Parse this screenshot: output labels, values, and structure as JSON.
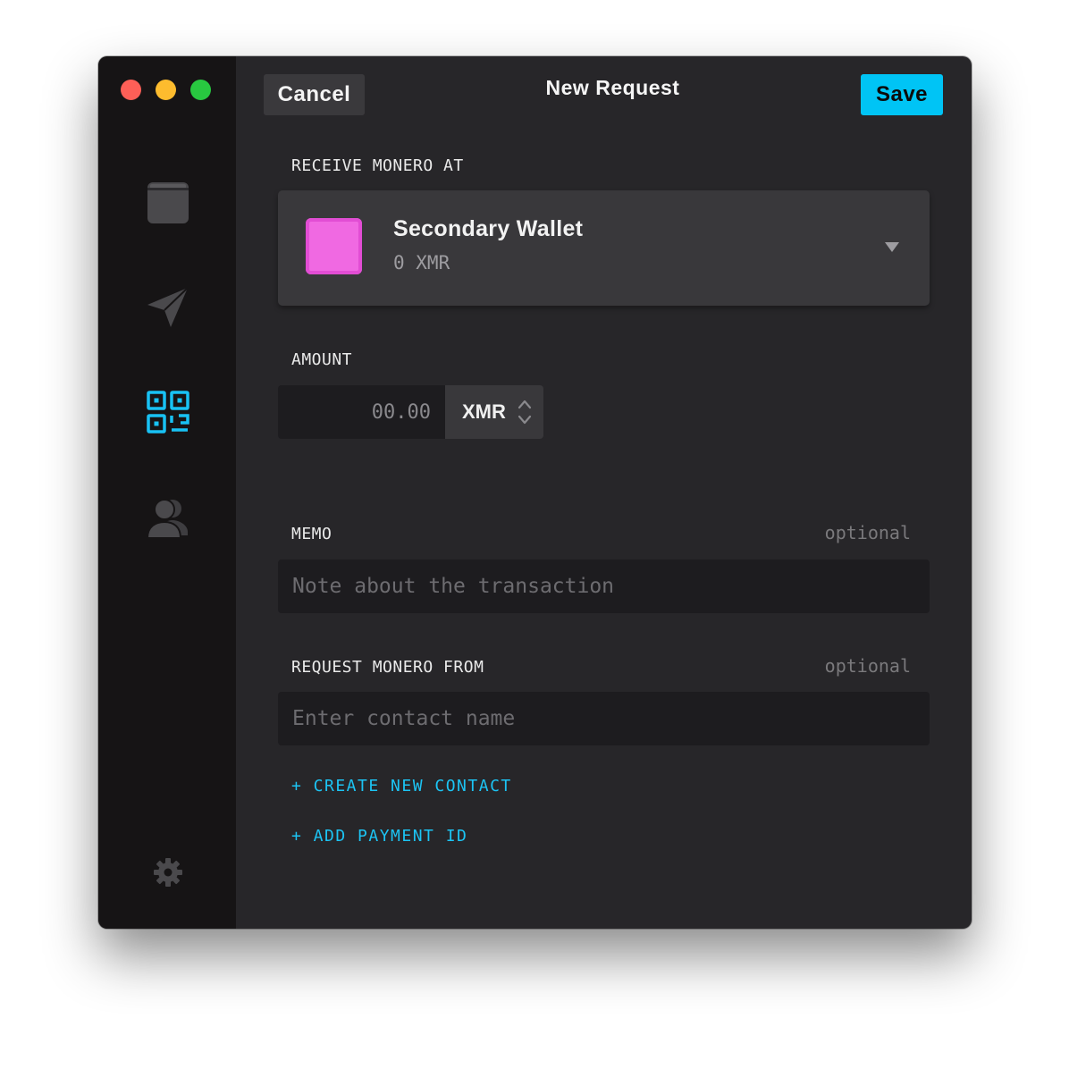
{
  "header": {
    "cancel_label": "Cancel",
    "title": "New Request",
    "save_label": "Save"
  },
  "sidebar": {
    "items": [
      {
        "id": "wallets",
        "icon": "wallet-icon",
        "active": false
      },
      {
        "id": "send",
        "icon": "paper-plane-icon",
        "active": false
      },
      {
        "id": "receive",
        "icon": "qr-code-icon",
        "active": true
      },
      {
        "id": "contacts",
        "icon": "contacts-icon",
        "active": false
      }
    ],
    "settings_icon": "gear-icon"
  },
  "receive_section": {
    "label": "RECEIVE MONERO AT",
    "wallet": {
      "name": "Secondary Wallet",
      "balance": "0 XMR",
      "color": "#f069e2"
    }
  },
  "amount_section": {
    "label": "AMOUNT",
    "placeholder": "00.00",
    "currency": "XMR"
  },
  "memo_section": {
    "label": "MEMO",
    "optional": "optional",
    "placeholder": "Note about the transaction"
  },
  "from_section": {
    "label": "REQUEST MONERO FROM",
    "optional": "optional",
    "placeholder": "Enter contact name"
  },
  "links": {
    "create_contact": "+ CREATE NEW CONTACT",
    "add_payment_id": "+ ADD PAYMENT ID"
  },
  "colors": {
    "accent": "#00c4f5",
    "background": "#272629",
    "sidebar": "#161415"
  }
}
